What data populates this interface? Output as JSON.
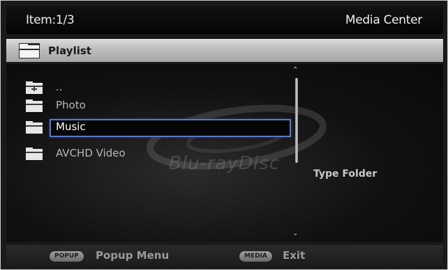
{
  "header": {
    "item_counter": "Item:1/3",
    "app_title": "Media Center"
  },
  "playlist_bar": {
    "icon": "folder-icon",
    "label": "Playlist"
  },
  "watermark": {
    "text": "Blu-rayDisc"
  },
  "list": {
    "items": [
      {
        "label": "..",
        "icon": "parent-folder-icon",
        "selected": false
      },
      {
        "label": "Photo",
        "icon": "folder-icon",
        "selected": false
      },
      {
        "label": "Music",
        "icon": "folder-icon",
        "selected": true
      },
      {
        "label": "AVCHD Video",
        "icon": "folder-icon",
        "selected": false
      }
    ]
  },
  "scrollbar": {
    "up_glyph": "⌃",
    "down_glyph": "⌄"
  },
  "details": {
    "type_text": "Type Folder"
  },
  "footer": {
    "popup_key": "POPUP",
    "popup_label": "Popup Menu",
    "media_key": "MEDIA",
    "media_label": "Exit"
  },
  "colors": {
    "selection_border": "#5a78c8",
    "background": "#1a1a1a",
    "playlist_bar": "#bdbdbd"
  }
}
